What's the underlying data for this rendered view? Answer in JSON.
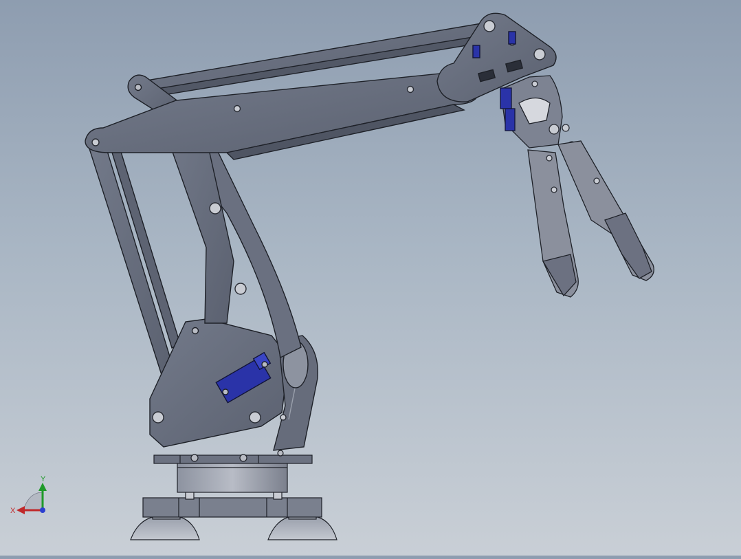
{
  "viewport": {
    "background_top": "#8e9db0",
    "background_bottom": "#c9cfd6"
  },
  "model": {
    "part_color": "#666c7c",
    "part_edge_color": "#1e2128",
    "servo_color": "#2a33a8",
    "metal_color": "#b9bcc4"
  },
  "triad": {
    "x_label": "X",
    "y_label": "Y",
    "x_color": "#c0282a",
    "y_color": "#1f9a2a",
    "z_color": "#2b3fd0"
  }
}
